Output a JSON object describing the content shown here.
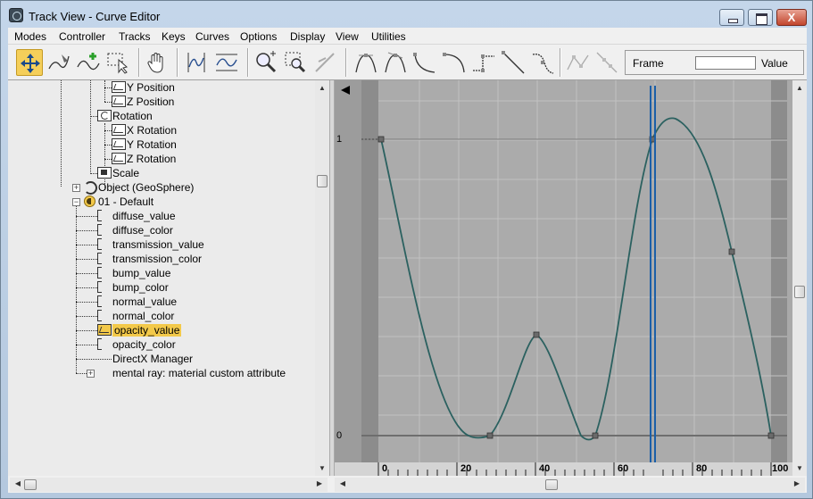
{
  "window": {
    "title": "Track View - Curve Editor",
    "controls": {
      "minimize": "",
      "maximize": "",
      "close": "X"
    }
  },
  "menu": [
    "Modes",
    "Controller",
    "Tracks",
    "Keys",
    "Curves",
    "Options",
    "Display",
    "View",
    "Utilities"
  ],
  "toolbar": {
    "tools": [
      "move-keys-icon",
      "draw-curves-icon",
      "add-keys-icon",
      "region-select-icon",
      "pan-hand-icon",
      "zoom-horizontal-extents-icon",
      "zoom-value-extents-icon",
      "zoom-icon",
      "zoom-region-icon",
      "isolate-curve-icon",
      "tangent-auto-icon",
      "tangent-custom-icon",
      "tangent-fast-icon",
      "tangent-slow-icon",
      "tangent-step-icon",
      "tangent-linear-icon",
      "tangent-smooth-icon",
      "lock-selection-icon",
      "snap-frames-icon"
    ],
    "frame_label": "Frame",
    "frame_value": "",
    "value_label": "Value"
  },
  "tree": [
    {
      "label": "Y Position",
      "icon": "curve-icon"
    },
    {
      "label": "Z Position",
      "icon": "curve-icon"
    },
    {
      "label": "Rotation",
      "icon": "rotation-icon"
    },
    {
      "label": "X Rotation",
      "icon": "curve-icon"
    },
    {
      "label": "Y Rotation",
      "icon": "curve-icon"
    },
    {
      "label": "Z Rotation",
      "icon": "curve-icon"
    },
    {
      "label": "Scale",
      "icon": "scale-icon"
    },
    {
      "label": "Object (GeoSphere)",
      "icon": "geosphere-icon"
    },
    {
      "label": "01 - Default",
      "icon": "material-icon"
    },
    {
      "label": "diffuse_value",
      "icon": "bracket-icon"
    },
    {
      "label": "diffuse_color",
      "icon": "bracket-icon"
    },
    {
      "label": "transmission_value",
      "icon": "bracket-icon"
    },
    {
      "label": "transmission_color",
      "icon": "bracket-icon"
    },
    {
      "label": "bump_value",
      "icon": "bracket-icon"
    },
    {
      "label": "bump_color",
      "icon": "bracket-icon"
    },
    {
      "label": "normal_value",
      "icon": "bracket-icon"
    },
    {
      "label": "normal_color",
      "icon": "bracket-icon"
    },
    {
      "label": "opacity_value",
      "icon": "curve-icon",
      "selected": true
    },
    {
      "label": "opacity_color",
      "icon": "bracket-icon"
    },
    {
      "label": "DirectX Manager",
      "icon": ""
    },
    {
      "label": "mental ray: material custom attribute",
      "icon": ""
    }
  ],
  "graph": {
    "y_ticks": [
      "1",
      "0"
    ],
    "ruler_labels": [
      "0",
      "20",
      "40",
      "60",
      "80",
      "100"
    ],
    "curve_color": "#2b6160",
    "time_slider_color": "#1a5fa8"
  }
}
